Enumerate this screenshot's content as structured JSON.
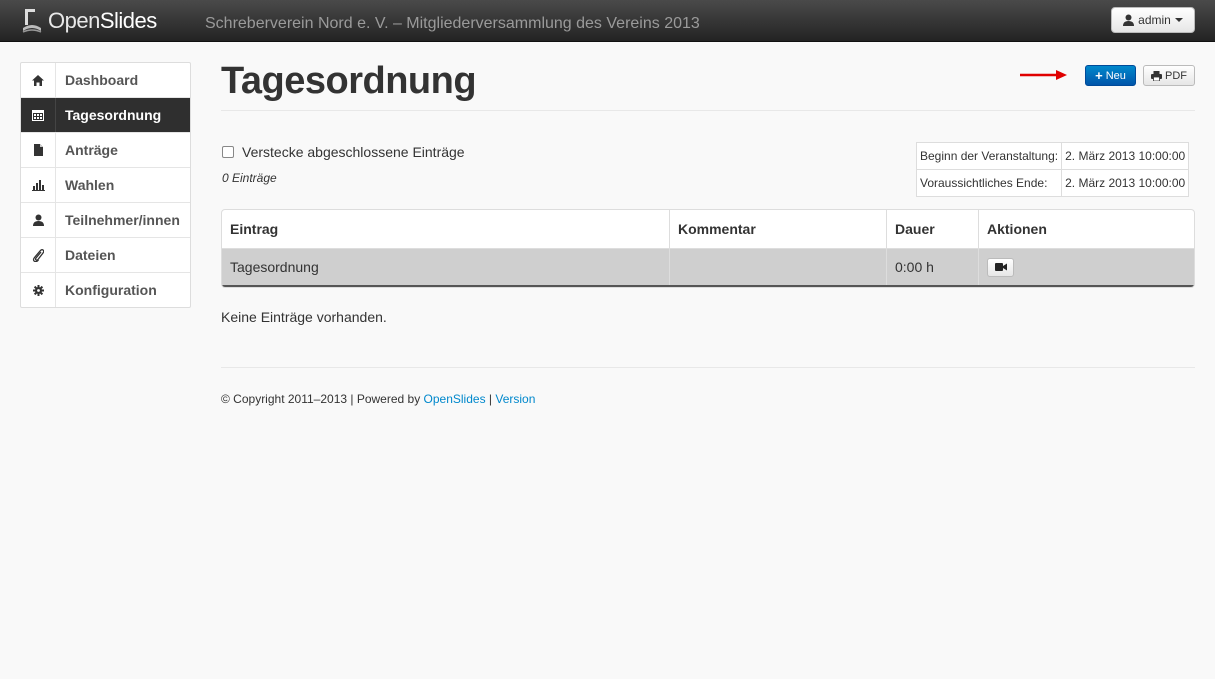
{
  "navbar": {
    "logo_prefix": "Open",
    "logo_suffix": "Slides",
    "event_title": "Schreberverein Nord e. V. – Mitgliederversammlung des Vereins 2013",
    "user_label": "admin"
  },
  "sidebar": {
    "items": [
      {
        "label": "Dashboard",
        "icon": "home-icon",
        "active": false
      },
      {
        "label": "Tagesordnung",
        "icon": "calendar-icon",
        "active": true
      },
      {
        "label": "Anträge",
        "icon": "file-icon",
        "active": false
      },
      {
        "label": "Wahlen",
        "icon": "bar-chart-icon",
        "active": false
      },
      {
        "label": "Teilnehmer/innen",
        "icon": "user-icon",
        "active": false
      },
      {
        "label": "Dateien",
        "icon": "paperclip-icon",
        "active": false
      },
      {
        "label": "Konfiguration",
        "icon": "cog-icon",
        "active": false
      }
    ]
  },
  "main": {
    "title": "Tagesordnung",
    "new_button": "Neu",
    "pdf_button": "PDF",
    "hide_closed_label": "Verstecke abgeschlossene Einträge",
    "count_label": "0 Einträge",
    "event_info": [
      {
        "label": "Beginn der Veranstaltung:",
        "value": "2. März 2013 10:00:00"
      },
      {
        "label": "Voraussichtliches Ende:",
        "value": "2. März 2013 10:00:00"
      }
    ],
    "table": {
      "headers": [
        "Eintrag",
        "Kommentar",
        "Dauer",
        "Aktionen"
      ],
      "rows": [
        {
          "entry": "Tagesordnung",
          "comment": "",
          "duration": "0:00 h"
        }
      ]
    },
    "empty_text": "Keine Einträge vorhanden."
  },
  "footer": {
    "copyright": "© Copyright 2011–2013 | Powered by ",
    "link_openslides": "OpenSlides",
    "separator": " | ",
    "link_version": "Version"
  },
  "colors": {
    "accent": "#0088cc",
    "navbar_bg": "#2b2b2b",
    "active_item_bg": "#2f2f2f",
    "arrow": "#e00000"
  }
}
